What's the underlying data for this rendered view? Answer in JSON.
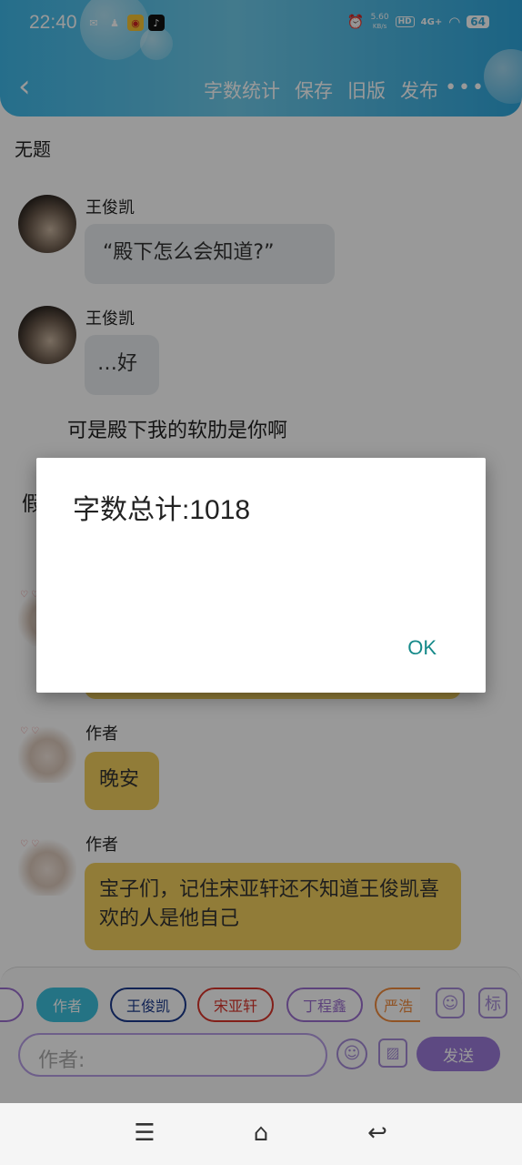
{
  "statusbar": {
    "time": "22:40",
    "net_speed_value": "5.60",
    "net_speed_unit": "KB/s",
    "hd": "HD",
    "signal": "4G+",
    "battery": "64",
    "icons": [
      "wechat-icon",
      "qq-icon",
      "weibo-icon",
      "tiktok-icon",
      "alarm-icon",
      "wifi-icon"
    ]
  },
  "header": {
    "back": "‹",
    "actions": [
      "字数统计",
      "保存",
      "旧版",
      "发布"
    ],
    "more": "•••"
  },
  "chat": {
    "title": "无题",
    "messages": [
      {
        "sender": "王俊凯",
        "text": "“殿下怎么会知道?”"
      },
      {
        "sender": "王俊凯",
        "text": "…好"
      }
    ],
    "narration_1": "可是殿下我的软肋是你啊",
    "narration_2_partial": "假",
    "author_messages": [
      {
        "sender": "作者",
        "text": "晚安"
      },
      {
        "sender": "作者",
        "text": "宝子们，记住宋亚轩还不知道王俊凯喜欢的人是他自己"
      }
    ]
  },
  "composer": {
    "chips": [
      "作者",
      "王俊凯",
      "宋亚轩",
      "丁程鑫",
      "严浩"
    ],
    "chip_colors": [
      "#3cc0dd",
      "#1b3a8c",
      "#d9342b",
      "#9b6fcf",
      "#f08a3c"
    ],
    "tag_button": "标",
    "input_placeholder": "作者:",
    "send": "发送"
  },
  "dialog": {
    "message": "字数总计:1018",
    "ok": "OK"
  }
}
